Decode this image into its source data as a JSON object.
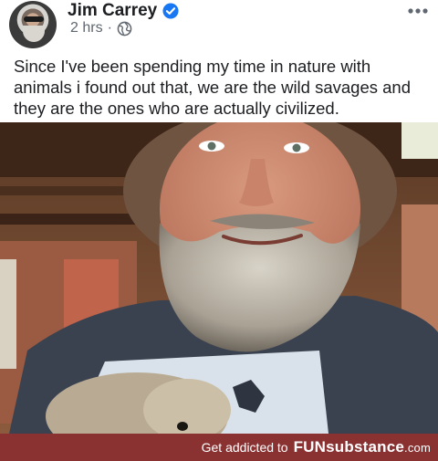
{
  "post": {
    "author": "Jim Carrey",
    "timestamp": "2 hrs",
    "separator": "·",
    "privacy_icon": "globe-icon",
    "verified_icon": "verified-badge-icon",
    "more_icon": "more-options-icon",
    "text": "Since I've been spending my time in nature with animals i found out that, we are the wild savages and they are the ones who are actually civilized."
  },
  "footer": {
    "tagline": "Get addicted to",
    "brand": "FUNsubstance",
    "domain": ".com",
    "background": "#8a3232"
  },
  "colors": {
    "text": "#1c1e21",
    "meta": "#606770",
    "verified": "#1877f2"
  }
}
